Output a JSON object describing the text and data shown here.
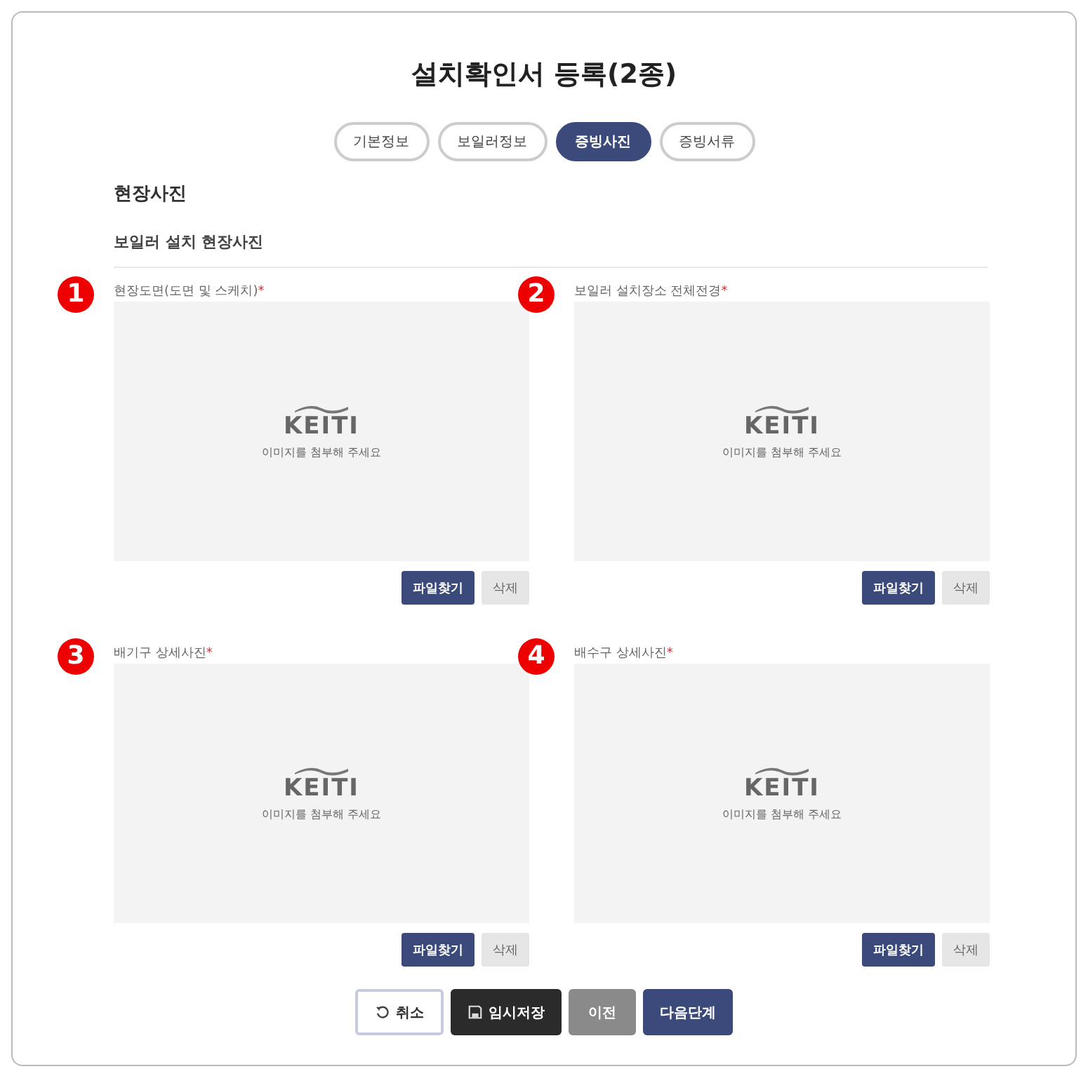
{
  "title": "설치확인서 등록(2종)",
  "tabs": [
    {
      "label": "기본정보",
      "selected": false
    },
    {
      "label": "보일러정보",
      "selected": false
    },
    {
      "label": "증빙사진",
      "selected": true
    },
    {
      "label": "증빙서류",
      "selected": false
    }
  ],
  "section_title": "현장사진",
  "subsection_title": "보일러 설치 현장사진",
  "uploads": [
    {
      "number": "1",
      "label": "현장도면(도면 및 스케치)",
      "required_mark": "*",
      "logo": "KEITI",
      "placeholder": "이미지를 첨부해 주세요",
      "buttons": [
        "파일찾기",
        "삭제"
      ]
    },
    {
      "number": "2",
      "label": "보일러 설치장소 전체전경",
      "required_mark": "*",
      "logo": "KEITI",
      "placeholder": "이미지를 첨부해 주세요",
      "buttons": [
        "파일찾기",
        "삭제"
      ]
    },
    {
      "number": "3",
      "label": "배기구 상세사진",
      "required_mark": "*",
      "logo": "KEITI",
      "placeholder": "이미지를 첨부해 주세요",
      "buttons": [
        "파일찾기",
        "삭제"
      ]
    },
    {
      "number": "4",
      "label": "배수구 상세사진",
      "required_mark": "*",
      "logo": "KEITI",
      "placeholder": "이미지를 첨부해 주세요",
      "buttons": [
        "파일찾기",
        "삭제"
      ]
    }
  ],
  "footer_buttons": [
    {
      "label": "취소",
      "kind": "reset"
    },
    {
      "label": "임시저장",
      "kind": "save"
    },
    {
      "label": "이전",
      "kind": "prev"
    },
    {
      "label": "다음단계",
      "kind": "next"
    }
  ]
}
